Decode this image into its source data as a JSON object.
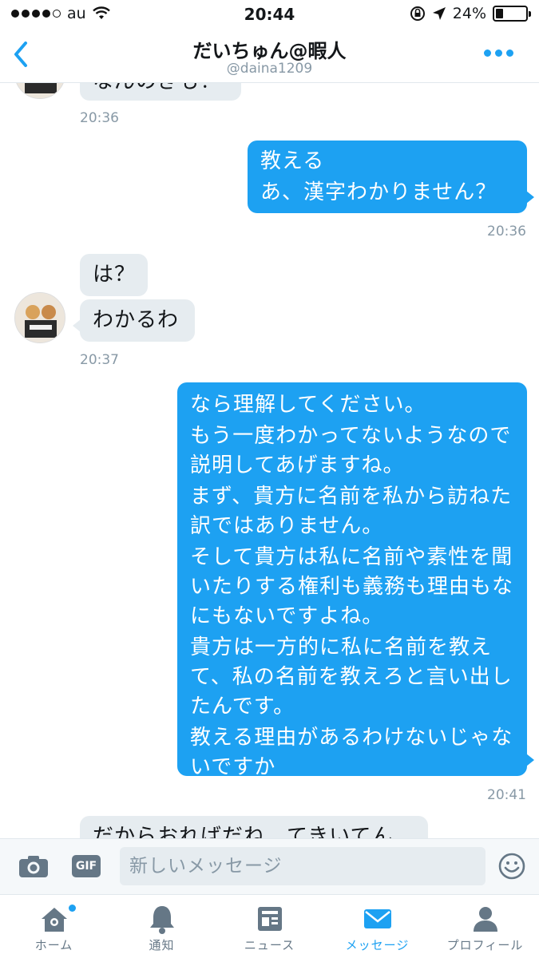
{
  "status_bar": {
    "carrier": "au",
    "time": "20:44",
    "battery": "24%",
    "battery_level": 0.24
  },
  "header": {
    "title": "だいちゅん@暇人",
    "handle": "@daina1209"
  },
  "messages": {
    "m0": {
      "text": "なんのきも！",
      "time": "20:36"
    },
    "m1": {
      "line1": "教える",
      "line2": "あ、漢字わかりません？",
      "time": "20:36"
    },
    "m2": {
      "text": "は？"
    },
    "m3": {
      "text": "わかるわ",
      "time": "20:37"
    },
    "m4": {
      "p1": "なら理解してください。",
      "p2": "もう一度わかってないようなので説明してあげますね。",
      "p3": "まず、貴方に名前を私から訪ねた訳ではありません。",
      "p4": "そして貴方は私に名前や素性を聞いたりする権利も義務も理由もなにもないですよね。",
      "p5": "貴方は一方的に私に名前を教えて、私の名前を教えろと言い出したんです。",
      "p6": "教える理由があるわけないじゃないですか",
      "time": "20:41"
    },
    "m5": {
      "text": "だからおればだね…てきいてん"
    }
  },
  "compose": {
    "gif_label": "GIF",
    "placeholder": "新しいメッセージ"
  },
  "tabs": {
    "home": "ホーム",
    "notifications": "通知",
    "news": "ニュース",
    "messages": "メッセージ",
    "profile": "プロフィール"
  },
  "colors": {
    "accent": "#1da1f2",
    "incoming_bubble": "#e6ecf0",
    "muted": "#8899a6"
  }
}
